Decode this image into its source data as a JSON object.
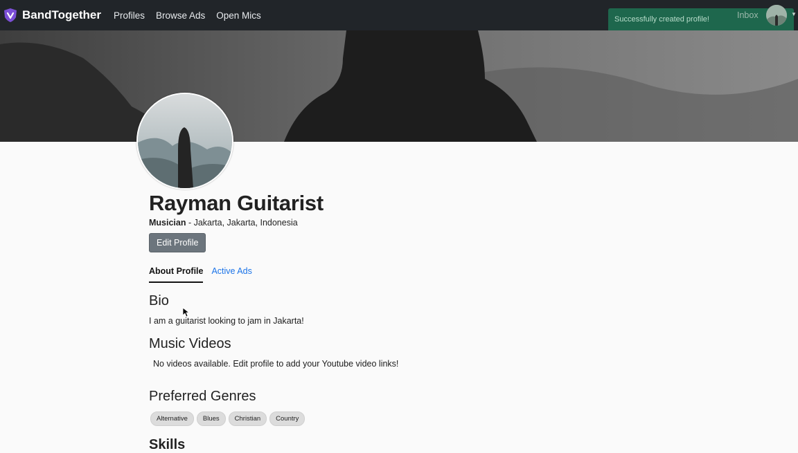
{
  "nav": {
    "brand": "BandTogether",
    "links": [
      "Profiles",
      "Browse Ads",
      "Open Mics"
    ],
    "inbox": "Inbox"
  },
  "toast": {
    "message": "Successfully created profile!"
  },
  "profile": {
    "name": "Rayman Guitarist",
    "role": "Musician",
    "location": " - Jakarta, Jakarta, Indonesia",
    "edit_label": "Edit Profile"
  },
  "tabs": {
    "about": "About Profile",
    "ads": "Active Ads"
  },
  "bio": {
    "heading": "Bio",
    "text": "I am a guitarist looking to jam in Jakarta!"
  },
  "videos": {
    "heading": "Music Videos",
    "empty": "No videos available. Edit profile to add your Youtube video links!"
  },
  "genres": {
    "heading": "Preferred Genres",
    "items": [
      "Alternative",
      "Blues",
      "Christian",
      "Country"
    ]
  },
  "skills": {
    "heading": "Skills"
  },
  "colors": {
    "navbar": "#212529",
    "toast": "#1e6b4f",
    "link": "#1a73e8",
    "button": "#6c757d"
  }
}
